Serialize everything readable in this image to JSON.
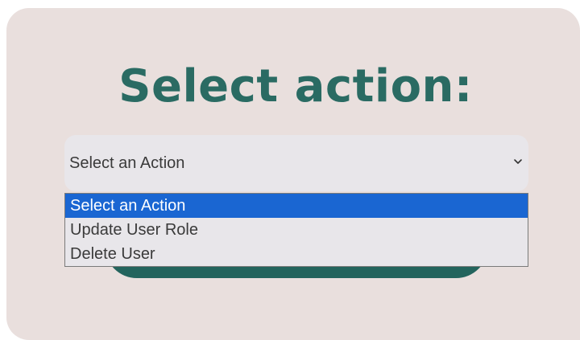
{
  "heading": "Select action:",
  "select": {
    "current_value": "Select an Action",
    "options": [
      {
        "label": "Select an Action",
        "selected": true
      },
      {
        "label": "Update User Role",
        "selected": false
      },
      {
        "label": "Delete User",
        "selected": false
      }
    ]
  },
  "icons": {
    "dropdown_arrow": "chevron-down-icon"
  },
  "colors": {
    "card_background": "#e9dfdd",
    "heading": "#2a6b63",
    "select_background": "#e8e6ea",
    "highlight": "#1a66d2",
    "button": "#23645d"
  }
}
